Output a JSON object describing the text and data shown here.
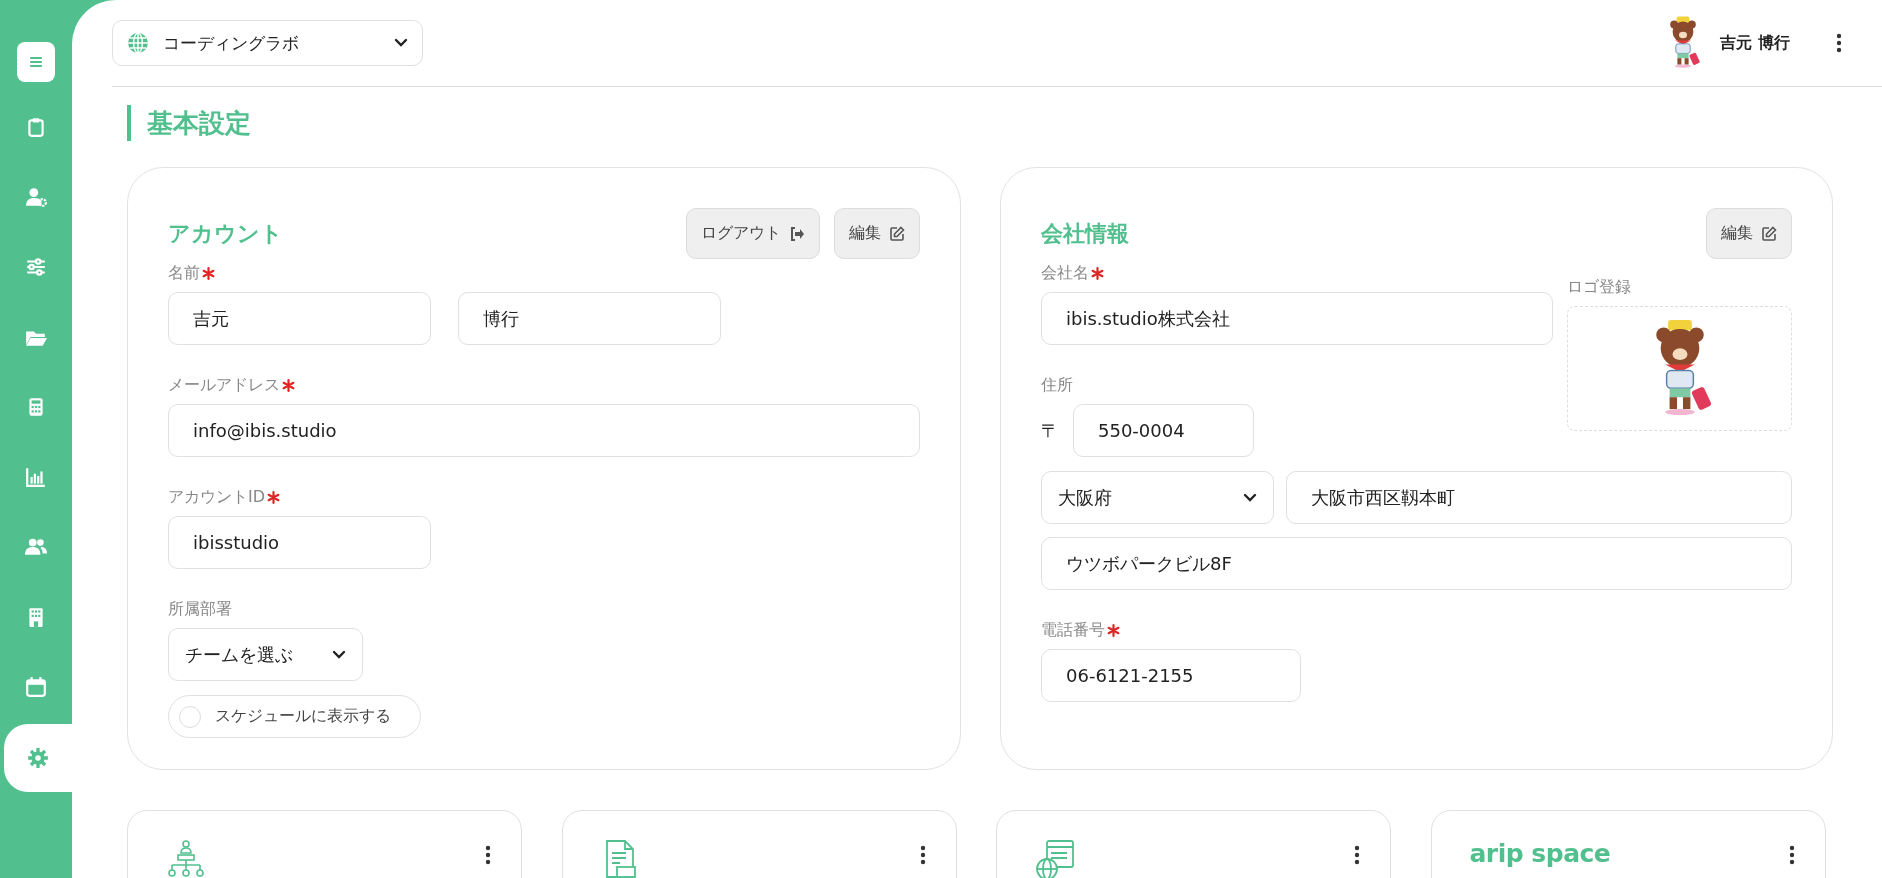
{
  "sidebar": {
    "items": [
      {
        "selected": false
      },
      {
        "selected": false
      },
      {
        "selected": false
      },
      {
        "selected": false
      },
      {
        "selected": false
      },
      {
        "selected": false
      },
      {
        "selected": false
      },
      {
        "selected": false
      },
      {
        "selected": false
      },
      {
        "selected": true
      }
    ]
  },
  "topbar": {
    "workspace": "コーディングラボ",
    "user_name": "吉元 博行"
  },
  "page_title": "基本設定",
  "account": {
    "title": "アカウント",
    "buttons": [
      "ログアウト",
      "編集"
    ],
    "name_label": {
      "text": "名前",
      "required": true
    },
    "last_name": "吉元",
    "first_name": "博行",
    "email_label": {
      "text": "メールアドレス",
      "required": true
    },
    "email": "info@ibis.studio",
    "id_label": {
      "text": "アカウントID",
      "required": true
    },
    "account_id": "ibisstudio",
    "department_label": {
      "text": "所属部署",
      "required": false
    },
    "department": "チームを選ぶ",
    "schedule_toggle": {
      "label": "スケジュールに表示する",
      "checked": false
    }
  },
  "company": {
    "title": "会社情報",
    "button": "編集",
    "name_label": {
      "text": "会社名",
      "required": true
    },
    "company_name": "ibis.studio株式会社",
    "logo_label": "ロゴ登録",
    "address_label": {
      "text": "住所",
      "required": false
    },
    "postal_mark": "〒",
    "postal_code": "550-0004",
    "prefecture": "大阪府",
    "city": "大阪市西区靱本町",
    "building": "ウツボパークビル8F",
    "phone_label": {
      "text": "電話番号",
      "required": true
    },
    "phone": "06-6121-2155"
  },
  "bottom_cards": [
    {
      "kind": "icon"
    },
    {
      "kind": "icon"
    },
    {
      "kind": "icon"
    },
    {
      "kind": "logo",
      "text": "arip space"
    }
  ]
}
